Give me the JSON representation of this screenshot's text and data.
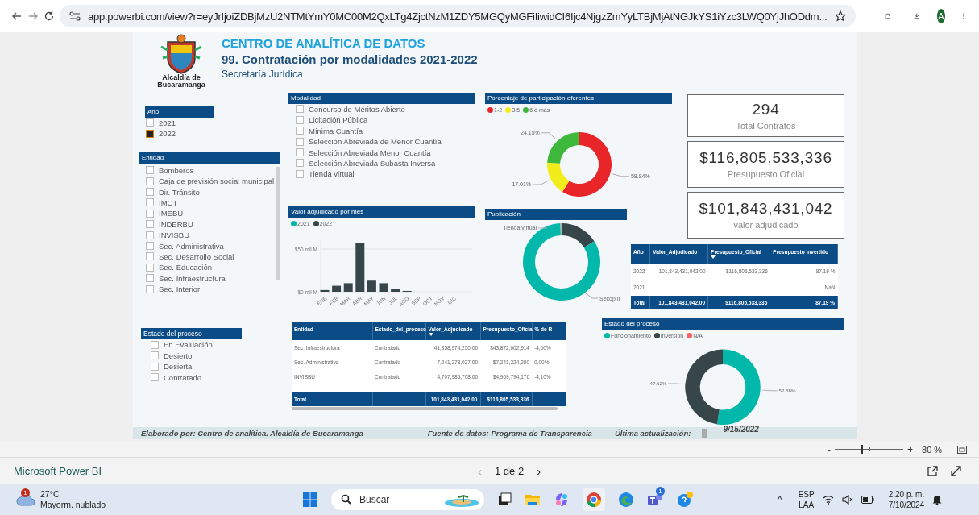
{
  "browser": {
    "url": "app.powerbi.com/view?r=eyJrIjoiZDBjMzU2NTMtYmY0MC00M2QxLTg4ZjctNzM1ZDY5MGQyMGFiIiwidCI6Ijc4NjgzZmYyLTBjMjAtNGJkYS1iYzc3LWQ0YjJhODdm...",
    "avatar": "A"
  },
  "report": {
    "header": {
      "logo_caption": "Alcaldía de Bucaramanga",
      "kicker": "CENTRO DE ANALÍTICA DE DATOS",
      "title": "99. Contratación por modalidades 2021-2022",
      "subtitle": "Secretaría Jurídica"
    },
    "slicer_anio": {
      "title": "Año",
      "items": [
        {
          "label": "2021",
          "checked": false
        },
        {
          "label": "2022",
          "checked": true
        }
      ]
    },
    "slicer_entidad": {
      "title": "Entidad",
      "items": [
        {
          "label": "Bomberos",
          "checked": false
        },
        {
          "label": "Caja de previsión social municipal",
          "checked": false
        },
        {
          "label": "Dir. Tránsito",
          "checked": false
        },
        {
          "label": "IMCT",
          "checked": false
        },
        {
          "label": "IMEBU",
          "checked": false
        },
        {
          "label": "INDERBU",
          "checked": false
        },
        {
          "label": "INVISBU",
          "checked": false
        },
        {
          "label": "Sec. Administrativa",
          "checked": false
        },
        {
          "label": "Sec. Desarrollo Social",
          "checked": false
        },
        {
          "label": "Sec. Educación",
          "checked": false
        },
        {
          "label": "Sec. Infraestructura",
          "checked": false
        },
        {
          "label": "Sec. Interior",
          "checked": false
        }
      ]
    },
    "slicer_modalidad": {
      "title": "Modalidad",
      "items": [
        {
          "label": "Concurso de Méritos Abierto",
          "checked": false
        },
        {
          "label": "Licitación Pública",
          "checked": false
        },
        {
          "label": "Mínima Cuantía",
          "checked": false
        },
        {
          "label": "Selección Abreviada de Menor Cuantía",
          "checked": false
        },
        {
          "label": "Selección Abreviada Menor Cuantía",
          "checked": false
        },
        {
          "label": "Selección Abreviada Subasta Inversa",
          "checked": false
        },
        {
          "label": "Tienda virtual",
          "checked": false
        }
      ]
    },
    "slicer_estado": {
      "title": "Estado del proceso",
      "items": [
        {
          "label": "En Evaluación",
          "checked": false
        },
        {
          "label": "Desierto",
          "checked": false
        },
        {
          "label": "Desierta",
          "checked": false
        },
        {
          "label": "Contratado",
          "checked": false
        }
      ]
    },
    "chart_oferentes": {
      "title": "Porcentaje de participación oferentes",
      "chart_data": {
        "type": "donut",
        "categories": [
          "1-2",
          "3-5",
          "6 ó más"
        ],
        "series": [
          {
            "colors": [
              "#e8262a",
              "#f2ec1c",
              "#3db83a"
            ],
            "values": [
              58.84,
              17.01,
              24.15
            ]
          }
        ],
        "value_labels": [
          "58.84%",
          "17.01%",
          "24.15%"
        ]
      }
    },
    "chart_mes": {
      "title": "Valor adjudicado por mes",
      "chart_data": {
        "type": "bar",
        "categories": [
          "ENE",
          "FEB",
          "MAR",
          "ABR",
          "MAY",
          "JUN",
          "JUL",
          "AGO",
          "SEP",
          "OCT",
          "NOV",
          "DIC"
        ],
        "series": [
          {
            "name": "2021",
            "color": "#01b8aa",
            "values": [
              null,
              null,
              null,
              null,
              null,
              null,
              null,
              null,
              null,
              null,
              null,
              null
            ]
          },
          {
            "name": "2022",
            "color": "#374649",
            "values": [
              2,
              7,
              10,
              57,
              13,
              10,
              3,
              1,
              null,
              null,
              null,
              null
            ]
          }
        ],
        "ylim": [
          0,
          60
        ],
        "yticks": [
          {
            "value": 0,
            "label": "$0 mil M"
          },
          {
            "value": 50,
            "label": "$50 mil M"
          }
        ]
      }
    },
    "chart_publicacion": {
      "title": "Publicación",
      "slices": [
        {
          "label": "Tienda virtual",
          "color": "#374649"
        },
        {
          "label": "Secop II",
          "color": "#01b8aa"
        }
      ]
    },
    "cards": [
      {
        "value": "294",
        "label": "Total Contratos",
        "kind": "count"
      },
      {
        "value": "$116,805,533,336",
        "label": "Presupuesto Oficial",
        "kind": "money"
      },
      {
        "value": "$101,843,431,042",
        "label": "valor adjudicado",
        "kind": "money"
      }
    ],
    "table_anual": {
      "columns": [
        {
          "label": "Año",
          "sorted": false
        },
        {
          "label": "Valor_Adjudicado",
          "sorted": false
        },
        {
          "label": "Presupuesto_Oficial",
          "sorted": true
        },
        {
          "label": "Presupuesto invertido",
          "sorted": false
        }
      ],
      "rows": [
        {
          "anio": "2022",
          "valor_adjudicado": "101,843,431,042.00",
          "presupuesto_oficial": "$116,805,533,336",
          "presupuesto_invertido": "87.19 %"
        },
        {
          "anio": "2021",
          "presupuesto_invertido": "NaN"
        }
      ],
      "total": {
        "anio": "Total",
        "valor_adjudicado": "101,843,431,042.00",
        "presupuesto_oficial": "$116,805,533,336",
        "presupuesto_invertido": "87.19 %"
      }
    },
    "table_entidad": {
      "columns": [
        {
          "label": "Entidad",
          "sorted": false
        },
        {
          "label": "Estado_del_proceso",
          "sorted": false
        },
        {
          "label": "Valor_Adjudicado",
          "sorted": true
        },
        {
          "label": "Presupuesto_Oficial",
          "sorted": false
        },
        {
          "label": "% de R",
          "sorted": false
        }
      ],
      "rows": [
        {
          "entidad": "Sec. Infraestructura",
          "estado": "Contratado",
          "valor_adjudicado": "41,858,974,250.00",
          "presupuesto_oficial": "$43,872,602,914",
          "pct": "-4,60%"
        },
        {
          "entidad": "Sec. Administrativa",
          "estado": "Contratado",
          "valor_adjudicado": "7,241,278,027.00",
          "presupuesto_oficial": "$7,241,324,290",
          "pct": "0,00%"
        },
        {
          "entidad": "INVISBU",
          "estado": "Contratado",
          "valor_adjudicado": "4,707,985,708.00",
          "presupuesto_oficial": "$4,909,794,176",
          "pct": "-4,10%"
        }
      ],
      "total": {
        "entidad": "Total",
        "valor_adjudicado": "101,843,431,042.00",
        "presupuesto_oficial": "$116,805,533,336"
      }
    },
    "chart_estado": {
      "title": "Estado del proceso",
      "chart_data": {
        "type": "donut",
        "categories": [
          "Funcionamiento",
          "Inversión",
          "N/A"
        ],
        "series": [
          {
            "colors": [
              "#01b8aa",
              "#374649",
              "#fd625e"
            ],
            "values": [
              52.38,
              47.62,
              0
            ]
          }
        ],
        "value_labels": [
          "52.38%",
          "47.62%",
          null
        ]
      }
    },
    "footer": {
      "made_by": "Elaborado por: Centro de analítica. Alcaldía de Bucaramanga",
      "source": "Fuente de datos: Programa de Transparencia",
      "updated_label": "Última actualización:",
      "updated_date": "9/15/2022"
    }
  },
  "zoom_bar": {
    "minus": "-",
    "plus": "+",
    "level": 0.38,
    "percent": "80 %"
  },
  "pbi_footer": {
    "brand": "Microsoft Power BI",
    "prev": "‹",
    "page": "1 de 2",
    "next": "›"
  },
  "taskbar": {
    "weather_badge": "1",
    "temperature": "27°C",
    "weather": "Mayorm. nublado",
    "search": "Buscar",
    "teams_badge": "1",
    "caret": "^",
    "lang": "ESP",
    "layout": "LAA",
    "time": "2:20 p. m.",
    "date": "7/10/2024"
  }
}
